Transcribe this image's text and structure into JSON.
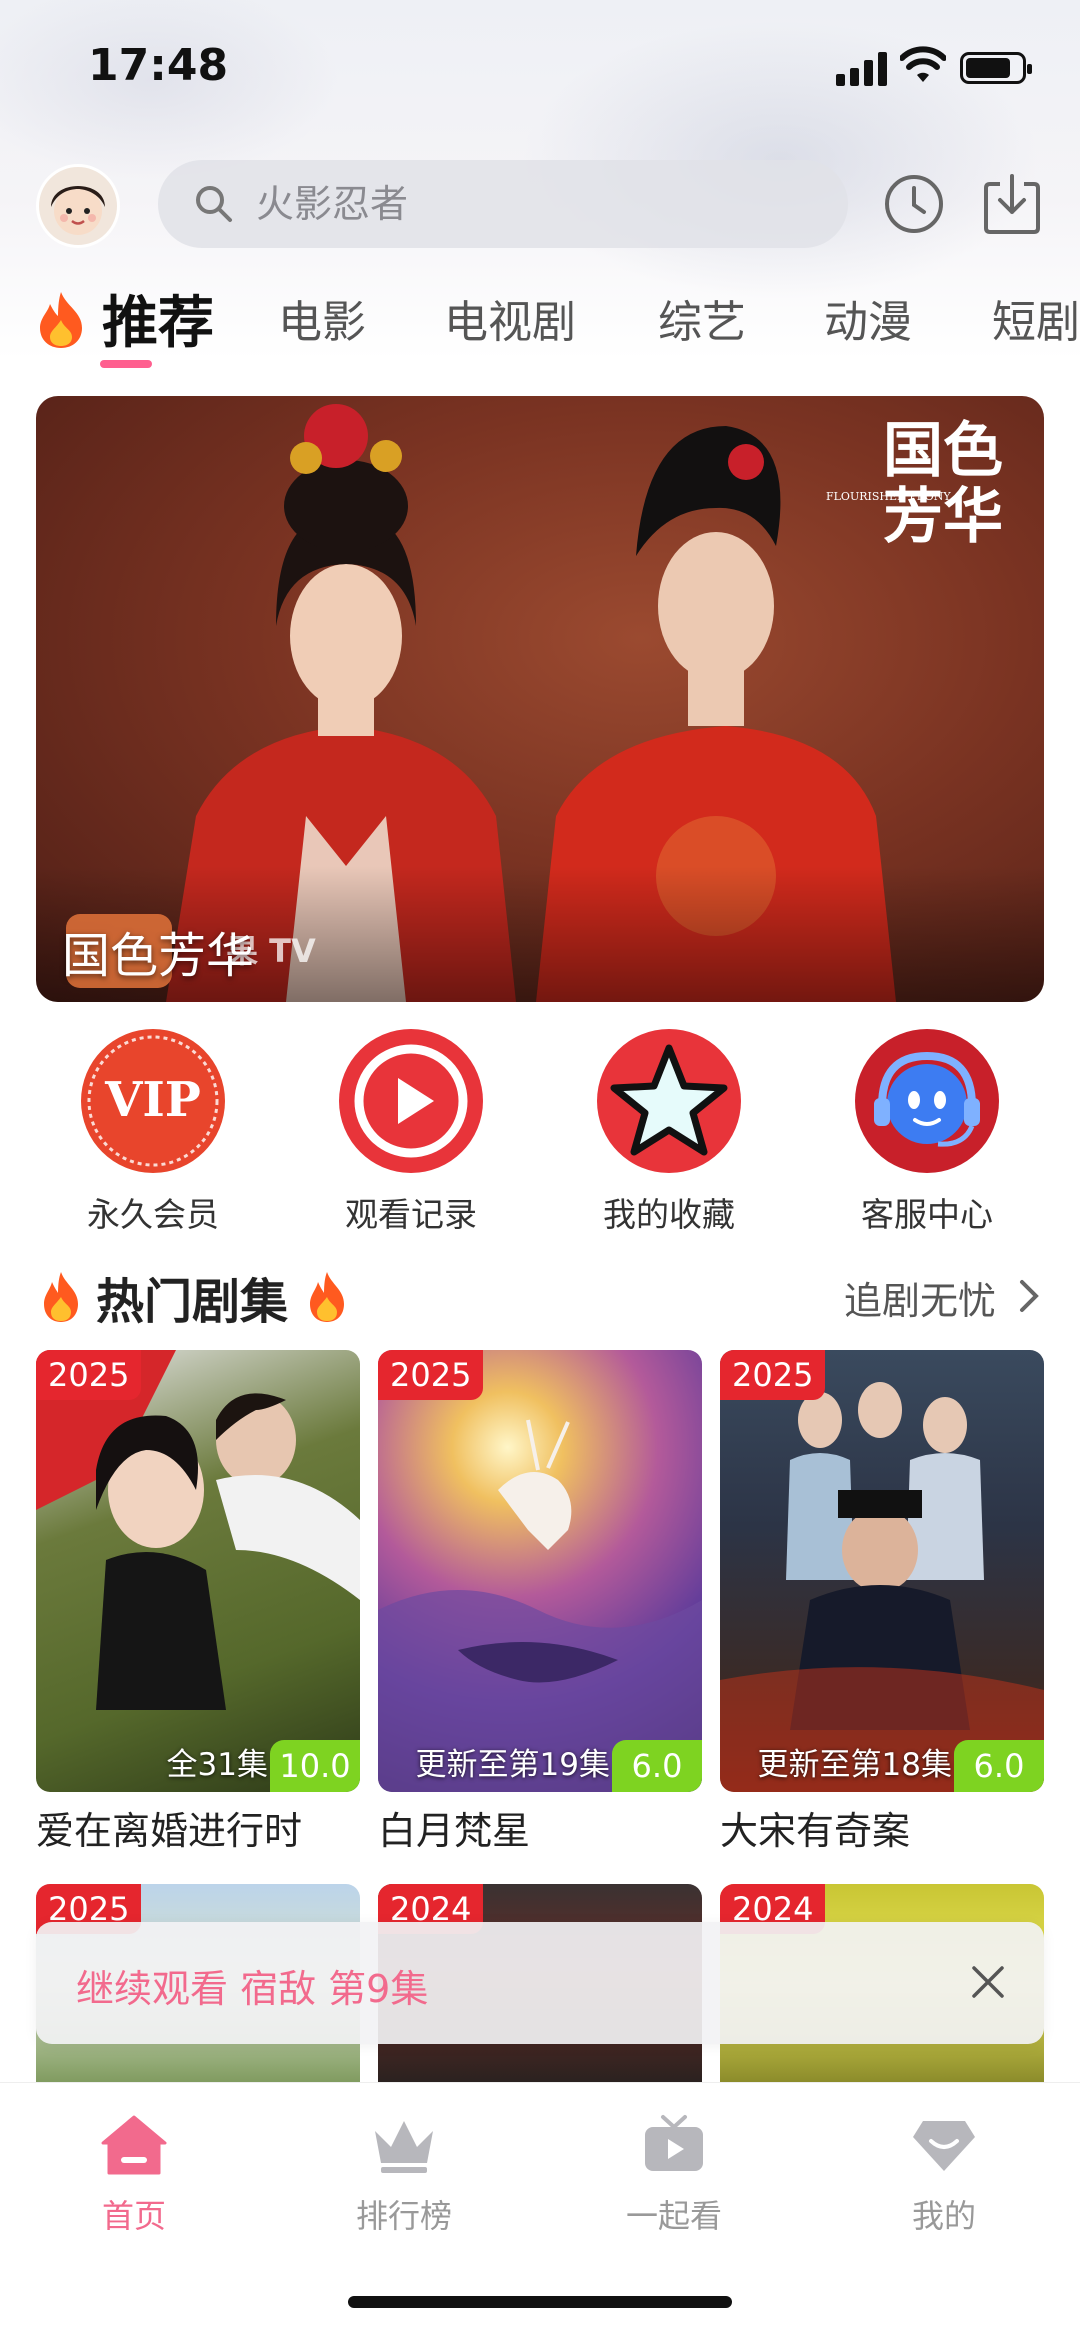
{
  "status_bar": {
    "time": "17:48"
  },
  "search": {
    "placeholder": "火影忍者"
  },
  "tabs": [
    {
      "label": "推荐",
      "active": true
    },
    {
      "label": "电影"
    },
    {
      "label": "电视剧"
    },
    {
      "label": "综艺"
    },
    {
      "label": "动漫"
    },
    {
      "label": "短剧"
    }
  ],
  "banner": {
    "title": "国色芳华",
    "logo_text": "果 TV",
    "poster_title": "国色芳华",
    "poster_subtitle": "FLOURISHED PEONY"
  },
  "quick_menu": [
    {
      "label": "永久会员",
      "icon": "vip-icon",
      "badge_text": "VIP",
      "color": "#e8452c"
    },
    {
      "label": "观看记录",
      "icon": "play-history-icon",
      "color": "#e8343a"
    },
    {
      "label": "我的收藏",
      "icon": "star-icon",
      "color": "#e8343a"
    },
    {
      "label": "客服中心",
      "icon": "customer-service-icon",
      "color": "#c8202a"
    }
  ],
  "hot_section": {
    "title": "热门剧集",
    "more": "追剧无忧"
  },
  "dramas": [
    {
      "year": "2025",
      "episodes": "全31集",
      "score": "10.0",
      "title": "爱在离婚进行时"
    },
    {
      "year": "2025",
      "episodes": "更新至第19集",
      "score": "6.0",
      "title": "白月梵星"
    },
    {
      "year": "2025",
      "episodes": "更新至第18集",
      "score": "6.0",
      "title": "大宋有奇案"
    }
  ],
  "dramas_row2": [
    {
      "year": "2025"
    },
    {
      "year": "2024"
    },
    {
      "year": "2024"
    }
  ],
  "continue_watching": {
    "text": "继续观看 宿敌 第9集"
  },
  "bottom_nav": [
    {
      "label": "首页",
      "icon": "home-icon",
      "active": true
    },
    {
      "label": "排行榜",
      "icon": "crown-icon"
    },
    {
      "label": "一起看",
      "icon": "tv-icon"
    },
    {
      "label": "我的",
      "icon": "profile-diamond-icon"
    }
  ],
  "colors": {
    "accent": "#f26a8d",
    "year_badge": "#e5262e",
    "score_badge": "#7ed321"
  }
}
